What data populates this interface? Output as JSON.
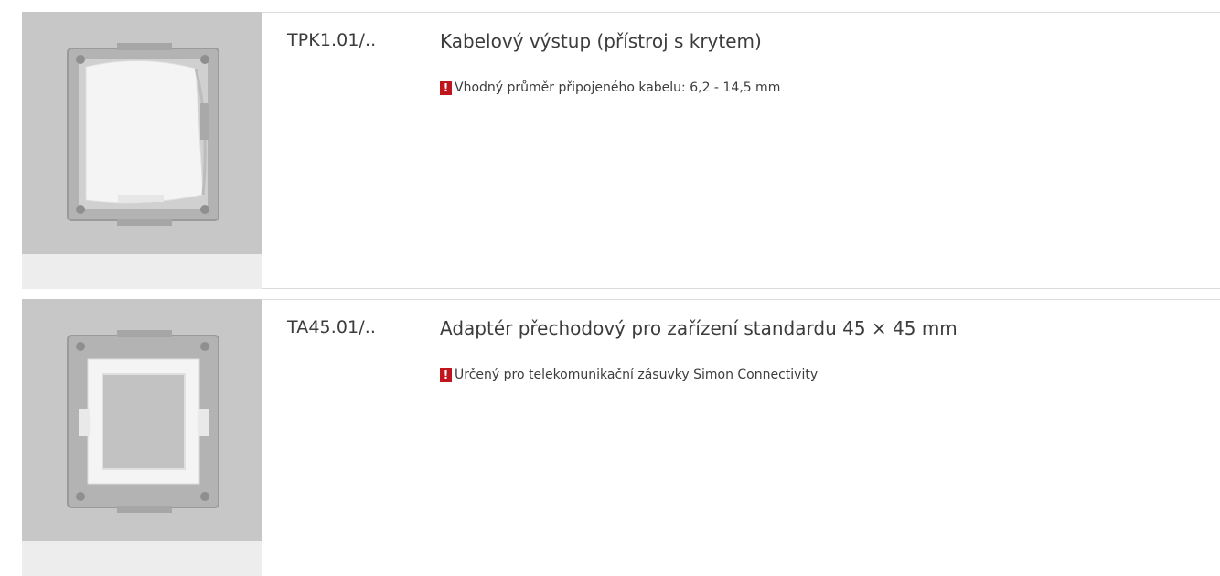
{
  "products": [
    {
      "code": "TPK1.01/..",
      "title": "Kabelový výstup (přístroj s krytem)",
      "note_icon": "!",
      "note": "Vhodný průměr připojeného kabelu: 6,2 - 14,5 mm"
    },
    {
      "code": "TA45.01/..",
      "title": "Adaptér přechodový pro zařízení standardu 45 × 45 mm",
      "note_icon": "!",
      "note": "Určený pro telekomunikační zásuvky Simon Connectivity"
    }
  ],
  "colors": {
    "warning": "#c0151c",
    "thumb_bg": "#c7c7c7",
    "rule": "#dcdcdc"
  }
}
